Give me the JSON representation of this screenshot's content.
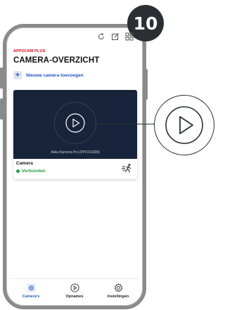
{
  "step_number": "10",
  "header": {
    "brand": "APP2CAM PLUS",
    "title": "CAMERA-OVERZICHT",
    "icons": [
      "refresh-icon",
      "edit-icon",
      "grid-icon"
    ]
  },
  "add_camera": {
    "icon": "plus-icon",
    "label": "Nieuwe camera toevoegen"
  },
  "camera_card": {
    "model": "Akku Kamera Pro [PPIC91000]",
    "name": "Camera",
    "status": "Verbonden",
    "status_color": "#1fa24a",
    "motion_icon": "motion-detection-icon"
  },
  "bottom_nav": [
    {
      "label": "Camera's",
      "icon": "camera-icon",
      "active": true
    },
    {
      "label": "Opnames",
      "icon": "play-circle-icon",
      "active": false
    },
    {
      "label": "Instellingen",
      "icon": "gear-icon",
      "active": false
    }
  ],
  "colors": {
    "brand_red": "#e2001a",
    "accent_blue": "#1f56c7",
    "video_bg": "#152035",
    "frame_gray": "#8a8a8a"
  }
}
